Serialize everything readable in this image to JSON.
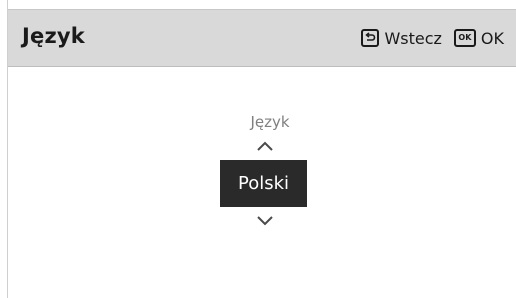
{
  "header": {
    "title": "Język",
    "back_label": "Wstecz",
    "ok_icon_text": "OK",
    "ok_label": "OK"
  },
  "selector": {
    "label": "Język",
    "selected_value": "Polski"
  },
  "icons": {
    "back": "back-return-icon",
    "ok": "ok-key-icon",
    "up": "chevron-up-icon",
    "down": "chevron-down-icon"
  },
  "colors": {
    "header_bg": "#d9d9d9",
    "selected_bg": "#2a2a2a",
    "selected_text": "#ffffff",
    "label_text": "#808080"
  }
}
